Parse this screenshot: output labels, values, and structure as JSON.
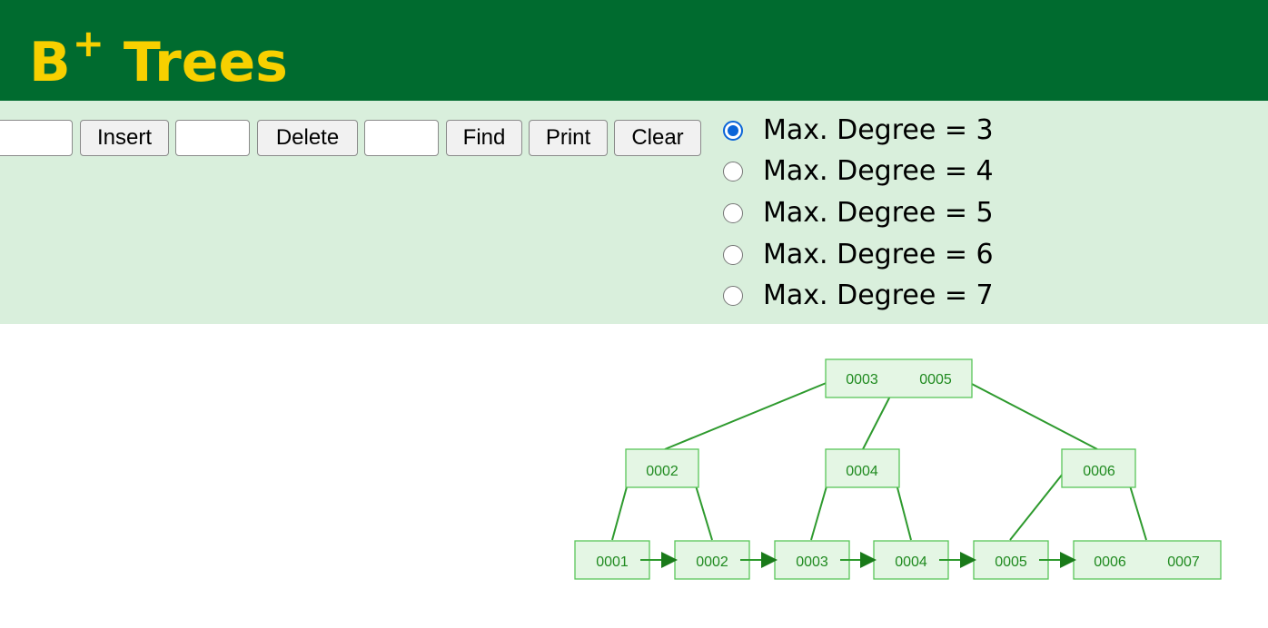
{
  "app": {
    "title_main": "B",
    "title_sup": "+",
    "title_rest": " Trees"
  },
  "toolbar": {
    "insert_label": "Insert",
    "delete_label": "Delete",
    "find_label": "Find",
    "print_label": "Print",
    "clear_label": "Clear",
    "insert_value": "",
    "delete_value": "",
    "find_value": ""
  },
  "degree_options": [
    {
      "label": "Max. Degree = 3",
      "checked": true
    },
    {
      "label": "Max. Degree = 4",
      "checked": false
    },
    {
      "label": "Max. Degree = 5",
      "checked": false
    },
    {
      "label": "Max. Degree = 6",
      "checked": false
    },
    {
      "label": "Max. Degree = 7",
      "checked": false
    }
  ],
  "tree": {
    "root": [
      "0003",
      "0005"
    ],
    "internal": [
      [
        "0002"
      ],
      [
        "0004"
      ],
      [
        "0006"
      ]
    ],
    "leaves": [
      [
        "0001"
      ],
      [
        "0002"
      ],
      [
        "0003"
      ],
      [
        "0004"
      ],
      [
        "0005"
      ],
      [
        "0006",
        "0007"
      ]
    ]
  },
  "colors": {
    "header_bg": "#006b2f",
    "title_color": "#f7d000",
    "controls_bg": "#d9efdc",
    "node_fill": "#e4f6e4",
    "node_stroke": "#59c659",
    "node_text": "#1f8a1f",
    "radio_accent": "#0a64d8"
  }
}
